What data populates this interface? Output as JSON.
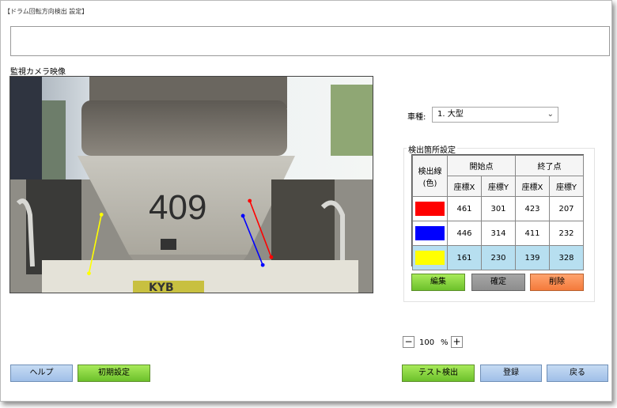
{
  "window": {
    "title": "【ドラム回転方向検出 設定】"
  },
  "camera": {
    "label": "監視カメラ映像",
    "plate_text": "409",
    "brand_text": "KYB",
    "lines": [
      {
        "color": "#ff0000",
        "start": [
          461,
          301
        ],
        "end": [
          423,
          207
        ]
      },
      {
        "color": "#0000ff",
        "start": [
          446,
          314
        ],
        "end": [
          411,
          232
        ]
      },
      {
        "color": "#ffff00",
        "start": [
          161,
          230
        ],
        "end": [
          139,
          328
        ]
      }
    ]
  },
  "vehicle": {
    "label": "車種:",
    "selected": "1. 大型"
  },
  "detection": {
    "title": "検出箇所設定",
    "headers": {
      "line_color": "検出線(色)",
      "start": "開始点",
      "end": "終了点",
      "x": "座標X",
      "y": "座標Y"
    },
    "rows": [
      {
        "color": "#ff0000",
        "start_x": "461",
        "start_y": "301",
        "end_x": "423",
        "end_y": "207"
      },
      {
        "color": "#0000ff",
        "start_x": "446",
        "start_y": "314",
        "end_x": "411",
        "end_y": "232"
      },
      {
        "color": "#ffff00",
        "start_x": "161",
        "start_y": "230",
        "end_x": "139",
        "end_y": "328"
      }
    ],
    "buttons": {
      "edit": "編集",
      "confirm": "確定",
      "delete": "削除"
    }
  },
  "zoom": {
    "minus": "−",
    "value": "100",
    "unit": "%",
    "plus": "+"
  },
  "footer": {
    "help": "ヘルプ",
    "init": "初期設定",
    "test": "テスト検出",
    "register": "登録",
    "back": "戻る"
  }
}
